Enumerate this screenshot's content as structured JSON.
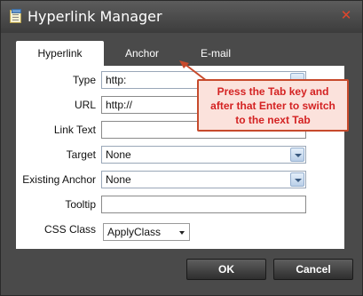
{
  "window": {
    "title": "Hyperlink Manager",
    "icon": "document-icon",
    "close_icon": "close-icon"
  },
  "tabs": [
    {
      "label": "Hyperlink",
      "active": true
    },
    {
      "label": "Anchor",
      "active": false
    },
    {
      "label": "E-mail",
      "active": false
    }
  ],
  "form": {
    "type": {
      "label": "Type",
      "value": "http:"
    },
    "url": {
      "label": "URL",
      "value": "http://"
    },
    "link_text": {
      "label": "Link Text",
      "value": ""
    },
    "target": {
      "label": "Target",
      "value": "None"
    },
    "existing_anchor": {
      "label": "Existing Anchor",
      "value": "None"
    },
    "tooltip": {
      "label": "Tooltip",
      "value": ""
    },
    "css_class": {
      "label": "CSS Class",
      "value": "ApplyClass"
    }
  },
  "buttons": {
    "ok": "OK",
    "cancel": "Cancel"
  },
  "callout": {
    "lines": [
      "Press the Tab key and",
      "after that Enter to switch",
      "to the next Tab"
    ],
    "color": "#d42222",
    "border_color": "#c74a2c"
  },
  "colors": {
    "chrome": "#4a4a4a",
    "accent_close": "#e0462c"
  }
}
